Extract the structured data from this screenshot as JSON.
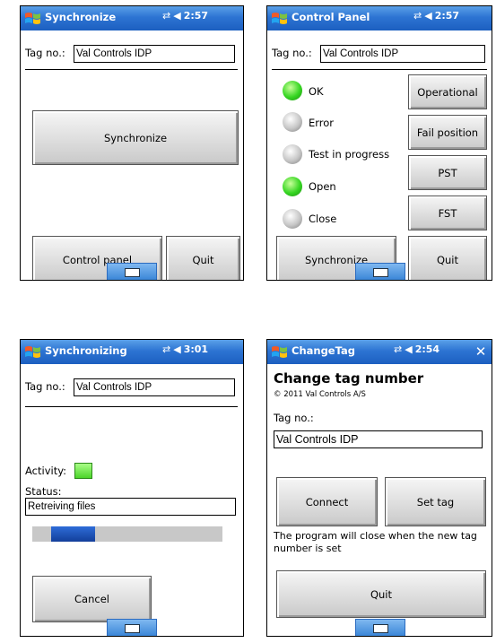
{
  "status_time": {
    "p1": "2:57",
    "p2": "2:57",
    "p3": "3:01",
    "p4": "2:54"
  },
  "panel1": {
    "title": "Synchronize",
    "tag_label": "Tag no.:",
    "tag_value": "Val Controls IDP",
    "synchronize_button": "Synchronize",
    "control_panel_button": "Control panel",
    "quit_button": "Quit"
  },
  "panel2": {
    "title": "Control Panel",
    "tag_label": "Tag no.:",
    "tag_value": "Val Controls IDP",
    "indicators": [
      {
        "label": "OK",
        "state": "on"
      },
      {
        "label": "Error",
        "state": "off"
      },
      {
        "label": "Test in progress",
        "state": "off"
      },
      {
        "label": "Open",
        "state": "on"
      },
      {
        "label": "Close",
        "state": "off"
      }
    ],
    "operational_button": "Operational",
    "fail_position_button": "Fail position",
    "pst_button": "PST",
    "fst_button": "FST",
    "synchronize_button": "Synchronize",
    "quit_button": "Quit"
  },
  "panel3": {
    "title": "Synchronizing",
    "tag_label": "Tag no.:",
    "tag_value": "Val Controls IDP",
    "activity_label": "Activity:",
    "status_label": "Status:",
    "status_value": "Retreiving files",
    "progress_fraction": 0.23,
    "cancel_button": "Cancel"
  },
  "panel4": {
    "title": "ChangeTag",
    "heading": "Change tag number",
    "copyright": "© 2011 Val Controls A/S",
    "tag_label": "Tag no.:",
    "tag_value": "Val Controls IDP",
    "connect_button": "Connect",
    "set_tag_button": "Set tag",
    "note": "The program will close when the new tag number is set",
    "quit_button": "Quit"
  },
  "colors": {
    "titlebar": "#2d74d3",
    "led_on": "#36d622",
    "led_off": "#c6c6c6",
    "progress": "#1f4fb8"
  },
  "icons": {
    "start": "windows-flag-icon",
    "connectivity": "connectivity-icon",
    "volume": "speaker-icon",
    "keyboard": "keyboard-icon",
    "close": "close-icon"
  }
}
